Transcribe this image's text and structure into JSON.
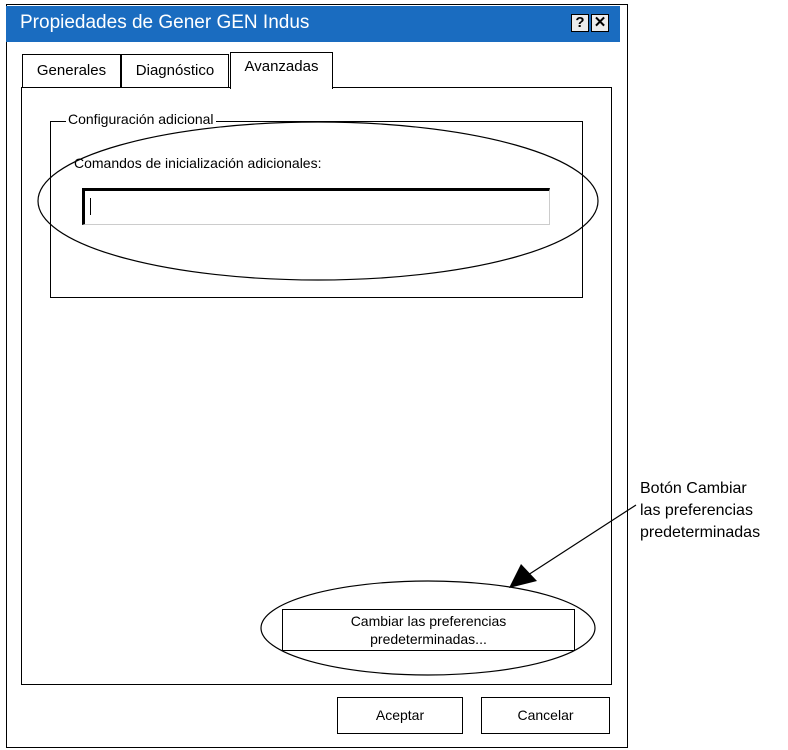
{
  "window": {
    "title": "Propiedades de Gener GEN Indus",
    "help_glyph": "?",
    "close_glyph": "✕"
  },
  "tabs": [
    {
      "label": "Generales",
      "active": false
    },
    {
      "label": "Diagnóstico",
      "active": false
    },
    {
      "label": "Avanzadas",
      "active": true
    }
  ],
  "group": {
    "title": "Configuración adicional",
    "field_label": "Comandos de inicialización adicionales:",
    "field_value": ""
  },
  "defaults_button": {
    "line1": "Cambiar las preferencias",
    "line2": "predeterminadas..."
  },
  "footer": {
    "ok_label": "Aceptar",
    "cancel_label": "Cancelar"
  },
  "annotation": {
    "line1": "Botón Cambiar",
    "line2": "las preferencias",
    "line3": "predeterminadas"
  },
  "colors": {
    "titlebar": "#1a6cc0",
    "title_text": "#ffffff"
  }
}
